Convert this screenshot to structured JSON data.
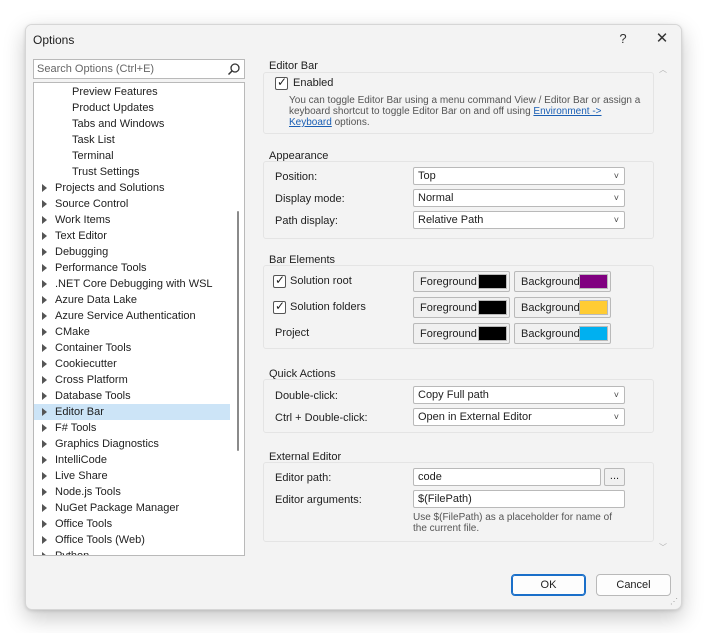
{
  "window": {
    "title": "Options",
    "help": "?",
    "close": "✕"
  },
  "search": {
    "placeholder": "Search Options (Ctrl+E)"
  },
  "tree": {
    "items": [
      {
        "label": "Preview Features",
        "child": true
      },
      {
        "label": "Product Updates",
        "child": true
      },
      {
        "label": "Tabs and Windows",
        "child": true
      },
      {
        "label": "Task List",
        "child": true
      },
      {
        "label": "Terminal",
        "child": true
      },
      {
        "label": "Trust Settings",
        "child": true
      },
      {
        "label": "Projects and Solutions"
      },
      {
        "label": "Source Control"
      },
      {
        "label": "Work Items"
      },
      {
        "label": "Text Editor"
      },
      {
        "label": "Debugging"
      },
      {
        "label": "Performance Tools"
      },
      {
        "label": ".NET Core Debugging with WSL"
      },
      {
        "label": "Azure Data Lake"
      },
      {
        "label": "Azure Service Authentication"
      },
      {
        "label": "CMake"
      },
      {
        "label": "Container Tools"
      },
      {
        "label": "Cookiecutter"
      },
      {
        "label": "Cross Platform"
      },
      {
        "label": "Database Tools"
      },
      {
        "label": "Editor Bar",
        "selected": true
      },
      {
        "label": "F# Tools"
      },
      {
        "label": "Graphics Diagnostics"
      },
      {
        "label": "IntelliCode"
      },
      {
        "label": "Live Share"
      },
      {
        "label": "Node.js Tools"
      },
      {
        "label": "NuGet Package Manager"
      },
      {
        "label": "Office Tools"
      },
      {
        "label": "Office Tools (Web)"
      },
      {
        "label": "Python"
      }
    ]
  },
  "editor_bar": {
    "title": "Editor Bar",
    "enabled_label": "Enabled",
    "enabled_checked": true,
    "desc_line1": "You can toggle Editor Bar using a menu command View / Editor Bar or assign a",
    "desc_line2_pre": "keyboard shortcut to toggle Editor Bar on and off using ",
    "desc_link1": "Environment ->",
    "desc_link2": "Keyboard",
    "desc_line3_post": " options."
  },
  "appearance": {
    "title": "Appearance",
    "position_label": "Position:",
    "position_value": "Top",
    "display_mode_label": "Display mode:",
    "display_mode_value": "Normal",
    "path_display_label": "Path display:",
    "path_display_value": "Relative Path"
  },
  "bar_elements": {
    "title": "Bar Elements",
    "foreground_label": "Foreground",
    "background_label": "Background",
    "rows": [
      {
        "label": "Solution root",
        "checked": true,
        "fg": "#000000",
        "bg": "#800080"
      },
      {
        "label": "Solution folders",
        "checked": true,
        "fg": "#000000",
        "bg": "#ffcc33"
      },
      {
        "label": "Project",
        "checked": null,
        "fg": "#000000",
        "bg": "#00b0f0"
      }
    ]
  },
  "quick_actions": {
    "title": "Quick Actions",
    "double_click_label": "Double-click:",
    "double_click_value": "Copy Full path",
    "ctrl_double_click_label": "Ctrl + Double-click:",
    "ctrl_double_click_value": "Open in External Editor"
  },
  "external_editor": {
    "title": "External Editor",
    "path_label": "Editor path:",
    "path_value": "code",
    "browse_label": "...",
    "args_label": "Editor arguments:",
    "args_value": "$(FilePath)",
    "hint_line1": "Use $(FilePath) as a placeholder for name of",
    "hint_line2": "the current file."
  },
  "buttons": {
    "ok": "OK",
    "cancel": "Cancel"
  }
}
